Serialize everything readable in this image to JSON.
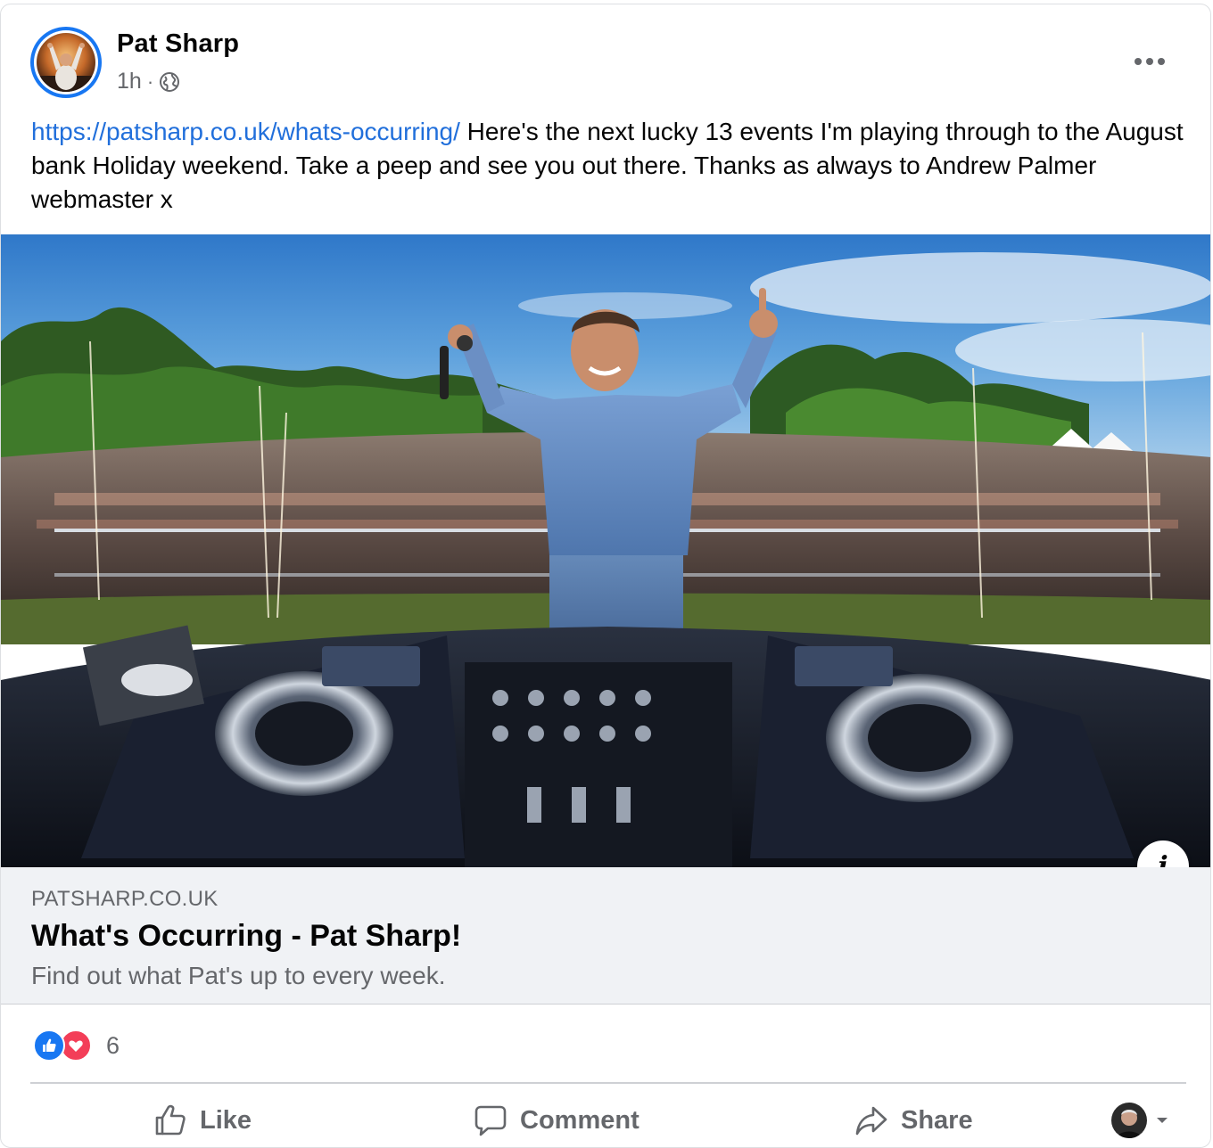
{
  "post": {
    "author": "Pat Sharp",
    "time": "1h",
    "separator": "·",
    "privacy_icon": "globe-icon",
    "more_icon": "more-horizontal-icon",
    "link_text": "https://patsharp.co.uk/whats-occurring/",
    "body": " Here's the next lucky 13 events I'm playing through to the August bank Holiday weekend. Take a peep and see you out there. Thanks as always to Andrew Palmer webmaster x"
  },
  "link_preview": {
    "domain": "PATSHARP.CO.UK",
    "title": "What's Occurring - Pat Sharp!",
    "description": "Find out what Pat's up to every week.",
    "info_label": "i"
  },
  "reactions": {
    "icons": [
      "like-icon",
      "love-icon"
    ],
    "count": "6"
  },
  "actions": {
    "like": "Like",
    "comment": "Comment",
    "share": "Share"
  },
  "colors": {
    "link": "#216fdb",
    "accent": "#1877f2",
    "love": "#f33e58",
    "secondary_text": "#65676b",
    "preview_bg": "#f0f2f5"
  }
}
